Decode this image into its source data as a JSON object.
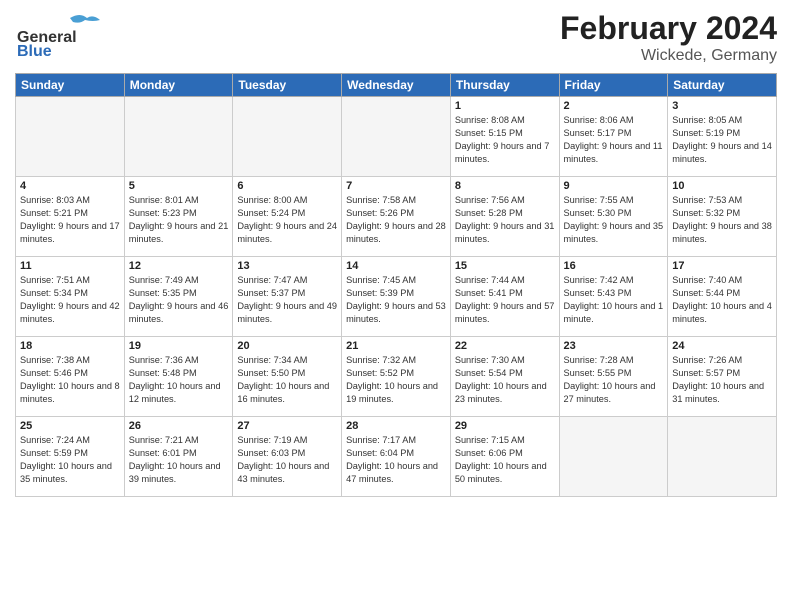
{
  "header": {
    "logo_general": "General",
    "logo_blue": "Blue",
    "month_year": "February 2024",
    "location": "Wickede, Germany"
  },
  "days_of_week": [
    "Sunday",
    "Monday",
    "Tuesday",
    "Wednesday",
    "Thursday",
    "Friday",
    "Saturday"
  ],
  "weeks": [
    [
      {
        "num": "",
        "empty": true
      },
      {
        "num": "",
        "empty": true
      },
      {
        "num": "",
        "empty": true
      },
      {
        "num": "",
        "empty": true
      },
      {
        "num": "1",
        "sunrise": "8:08 AM",
        "sunset": "5:15 PM",
        "daylight": "9 hours and 7 minutes."
      },
      {
        "num": "2",
        "sunrise": "8:06 AM",
        "sunset": "5:17 PM",
        "daylight": "9 hours and 11 minutes."
      },
      {
        "num": "3",
        "sunrise": "8:05 AM",
        "sunset": "5:19 PM",
        "daylight": "9 hours and 14 minutes."
      }
    ],
    [
      {
        "num": "4",
        "sunrise": "8:03 AM",
        "sunset": "5:21 PM",
        "daylight": "9 hours and 17 minutes."
      },
      {
        "num": "5",
        "sunrise": "8:01 AM",
        "sunset": "5:23 PM",
        "daylight": "9 hours and 21 minutes."
      },
      {
        "num": "6",
        "sunrise": "8:00 AM",
        "sunset": "5:24 PM",
        "daylight": "9 hours and 24 minutes."
      },
      {
        "num": "7",
        "sunrise": "7:58 AM",
        "sunset": "5:26 PM",
        "daylight": "9 hours and 28 minutes."
      },
      {
        "num": "8",
        "sunrise": "7:56 AM",
        "sunset": "5:28 PM",
        "daylight": "9 hours and 31 minutes."
      },
      {
        "num": "9",
        "sunrise": "7:55 AM",
        "sunset": "5:30 PM",
        "daylight": "9 hours and 35 minutes."
      },
      {
        "num": "10",
        "sunrise": "7:53 AM",
        "sunset": "5:32 PM",
        "daylight": "9 hours and 38 minutes."
      }
    ],
    [
      {
        "num": "11",
        "sunrise": "7:51 AM",
        "sunset": "5:34 PM",
        "daylight": "9 hours and 42 minutes."
      },
      {
        "num": "12",
        "sunrise": "7:49 AM",
        "sunset": "5:35 PM",
        "daylight": "9 hours and 46 minutes."
      },
      {
        "num": "13",
        "sunrise": "7:47 AM",
        "sunset": "5:37 PM",
        "daylight": "9 hours and 49 minutes."
      },
      {
        "num": "14",
        "sunrise": "7:45 AM",
        "sunset": "5:39 PM",
        "daylight": "9 hours and 53 minutes."
      },
      {
        "num": "15",
        "sunrise": "7:44 AM",
        "sunset": "5:41 PM",
        "daylight": "9 hours and 57 minutes."
      },
      {
        "num": "16",
        "sunrise": "7:42 AM",
        "sunset": "5:43 PM",
        "daylight": "10 hours and 1 minute."
      },
      {
        "num": "17",
        "sunrise": "7:40 AM",
        "sunset": "5:44 PM",
        "daylight": "10 hours and 4 minutes."
      }
    ],
    [
      {
        "num": "18",
        "sunrise": "7:38 AM",
        "sunset": "5:46 PM",
        "daylight": "10 hours and 8 minutes."
      },
      {
        "num": "19",
        "sunrise": "7:36 AM",
        "sunset": "5:48 PM",
        "daylight": "10 hours and 12 minutes."
      },
      {
        "num": "20",
        "sunrise": "7:34 AM",
        "sunset": "5:50 PM",
        "daylight": "10 hours and 16 minutes."
      },
      {
        "num": "21",
        "sunrise": "7:32 AM",
        "sunset": "5:52 PM",
        "daylight": "10 hours and 19 minutes."
      },
      {
        "num": "22",
        "sunrise": "7:30 AM",
        "sunset": "5:54 PM",
        "daylight": "10 hours and 23 minutes."
      },
      {
        "num": "23",
        "sunrise": "7:28 AM",
        "sunset": "5:55 PM",
        "daylight": "10 hours and 27 minutes."
      },
      {
        "num": "24",
        "sunrise": "7:26 AM",
        "sunset": "5:57 PM",
        "daylight": "10 hours and 31 minutes."
      }
    ],
    [
      {
        "num": "25",
        "sunrise": "7:24 AM",
        "sunset": "5:59 PM",
        "daylight": "10 hours and 35 minutes."
      },
      {
        "num": "26",
        "sunrise": "7:21 AM",
        "sunset": "6:01 PM",
        "daylight": "10 hours and 39 minutes."
      },
      {
        "num": "27",
        "sunrise": "7:19 AM",
        "sunset": "6:03 PM",
        "daylight": "10 hours and 43 minutes."
      },
      {
        "num": "28",
        "sunrise": "7:17 AM",
        "sunset": "6:04 PM",
        "daylight": "10 hours and 47 minutes."
      },
      {
        "num": "29",
        "sunrise": "7:15 AM",
        "sunset": "6:06 PM",
        "daylight": "10 hours and 50 minutes."
      },
      {
        "num": "",
        "empty": true
      },
      {
        "num": "",
        "empty": true
      }
    ]
  ]
}
